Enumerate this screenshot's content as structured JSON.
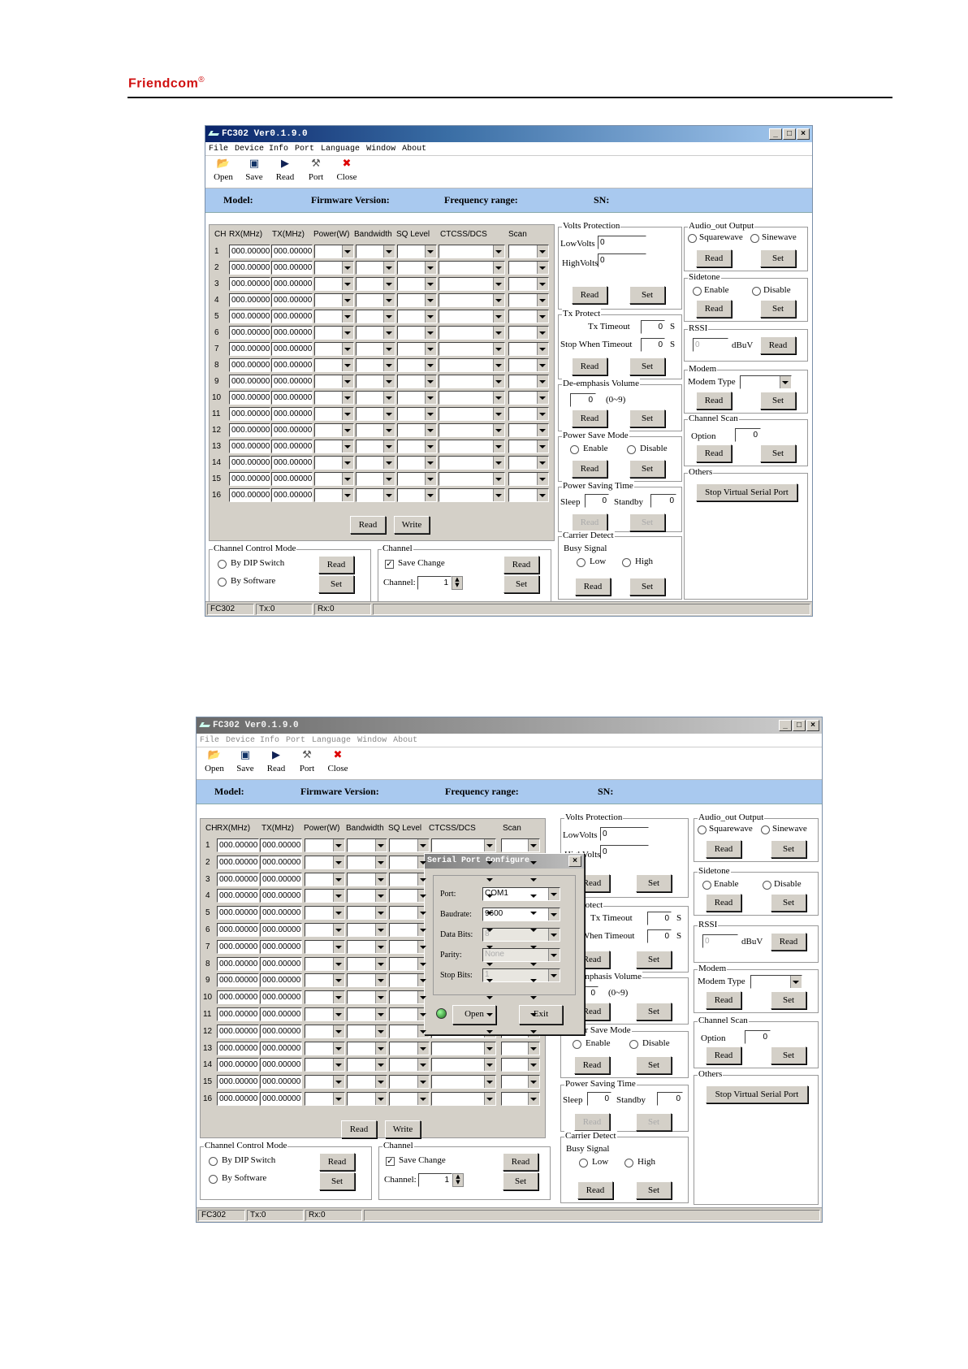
{
  "brand": {
    "name": "Friendcom",
    "mark": "®"
  },
  "window1": {
    "title": "FC302 Ver0.1.9.0",
    "menu": [
      "File",
      "Device Info",
      "Port",
      "Language",
      "Window",
      "About"
    ],
    "toolbar": [
      "Open",
      "Save",
      "Read",
      "Port",
      "Close"
    ],
    "info": {
      "model": "Model:",
      "firmware": "Firmware Version:",
      "frequency": "Frequency range:",
      "sn": "SN:"
    },
    "channels": {
      "headers": [
        "CH",
        "RX(MHz)",
        "TX(MHz)",
        "Power(W)",
        "Bandwidth",
        "SQ Level",
        "CTCSS/DCS",
        "Scan"
      ],
      "rows": [
        "1",
        "2",
        "3",
        "4",
        "5",
        "6",
        "7",
        "8",
        "9",
        "10",
        "11",
        "12",
        "13",
        "14",
        "15",
        "16"
      ],
      "rx_value": "000.00000",
      "tx_value": "000.00000",
      "read": "Read",
      "write": "Write"
    },
    "channel_control": {
      "title": "Channel Control Mode",
      "dip": "By DIP Switch",
      "software": "By Software",
      "read": "Read",
      "set": "Set"
    },
    "channel": {
      "title": "Channel",
      "save_change": "Save Change",
      "channel_label": "Channel:",
      "channel_value": "1",
      "read": "Read",
      "set": "Set"
    },
    "volts": {
      "title": "Volts Protection",
      "low": "LowVolts",
      "low_value": "0",
      "high": "HighVolts",
      "high_value": "0",
      "read": "Read",
      "set": "Set"
    },
    "tx_protect": {
      "title": "Tx Protect",
      "timeout": "Tx Timeout",
      "timeout_value": "0",
      "stop": "Stop When Timeout",
      "stop_value": "0",
      "unit": "S",
      "read": "Read",
      "set": "Set"
    },
    "deemphasis": {
      "title": "De-emphasis Volume",
      "value": "0",
      "range": "(0~9)",
      "read": "Read",
      "set": "Set"
    },
    "power_save": {
      "title": "Power Save Mode",
      "enable": "Enable",
      "disable": "Disable",
      "read": "Read",
      "set": "Set"
    },
    "power_time": {
      "title": "Power Saving Time",
      "sleep": "Sleep",
      "sleep_value": "0",
      "standby": "Standby",
      "standby_value": "0",
      "read": "Read",
      "set": "Set"
    },
    "carrier": {
      "title": "Carrier Detect",
      "busy": "Busy Signal",
      "low": "Low",
      "high": "High",
      "read": "Read",
      "set": "Set"
    },
    "audio": {
      "title": "Audio_out Output",
      "square": "Squarewave",
      "sine": "Sinewave",
      "read": "Read",
      "set": "Set"
    },
    "sidetone": {
      "title": "Sidetone",
      "enable": "Enable",
      "disable": "Disable",
      "read": "Read",
      "set": "Set"
    },
    "rssi": {
      "title": "RSSI",
      "value": "0",
      "unit": "dBuV",
      "read": "Read"
    },
    "modem": {
      "title": "Modem",
      "type": "Modem Type",
      "read": "Read",
      "set": "Set"
    },
    "scan": {
      "title": "Channel Scan",
      "option": "Option",
      "value": "0",
      "read": "Read",
      "set": "Set"
    },
    "others": {
      "title": "Others",
      "stop": "Stop Virtual Serial Port"
    },
    "status": [
      "FC302",
      "Tx:0",
      "Rx:0"
    ]
  },
  "dialog": {
    "title": "Serial Port Configure",
    "port_label": "Port:",
    "port_value": "COM1",
    "baud_label": "Baudrate:",
    "baud_value": "9600",
    "data_label": "Data Bits:",
    "data_value": "8",
    "parity_label": "Parity:",
    "parity_value": "None",
    "stop_label": "Stop Bits:",
    "stop_value": "1",
    "open": "Open",
    "exit": "Exit"
  }
}
